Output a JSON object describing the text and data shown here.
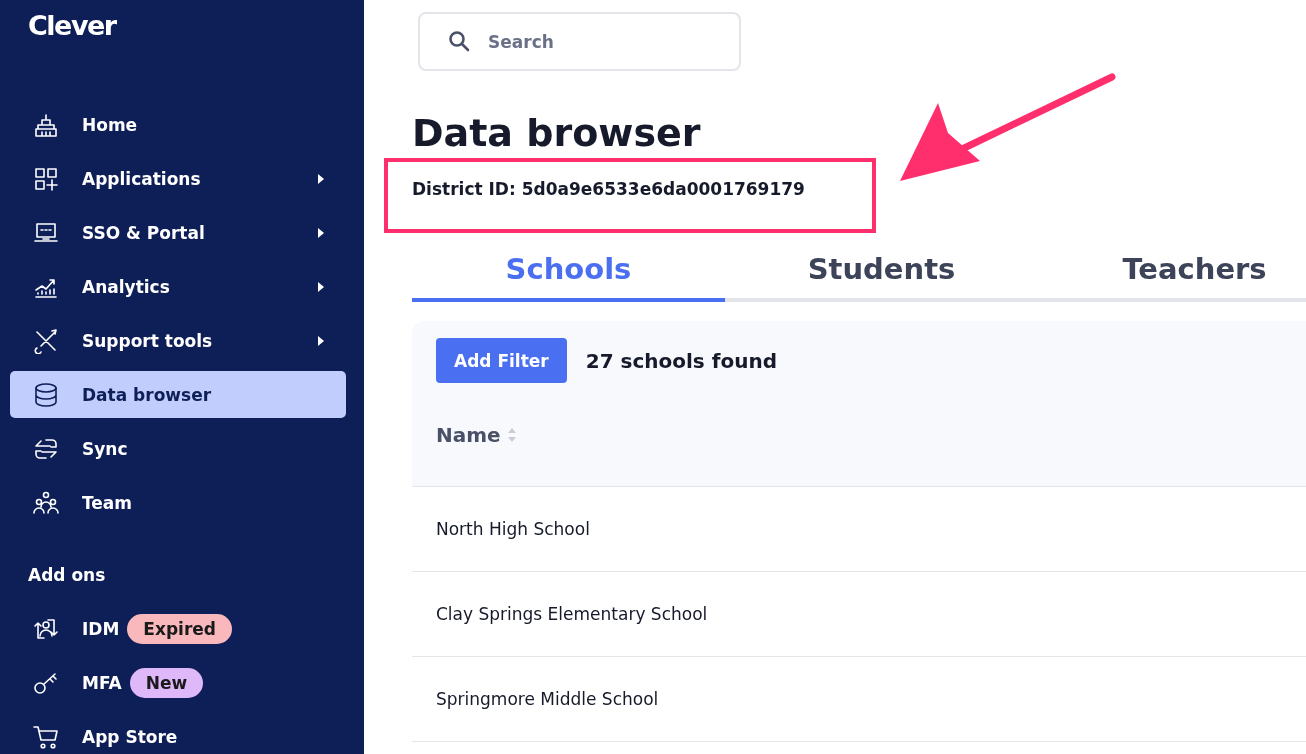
{
  "sidebar": {
    "logo": "Clever",
    "items": [
      {
        "label": "Home",
        "submenu": false,
        "selected": false
      },
      {
        "label": "Applications",
        "submenu": true,
        "selected": false
      },
      {
        "label": "SSO & Portal",
        "submenu": true,
        "selected": false
      },
      {
        "label": "Analytics",
        "submenu": true,
        "selected": false
      },
      {
        "label": "Support tools",
        "submenu": true,
        "selected": false
      },
      {
        "label": "Data browser",
        "submenu": false,
        "selected": true
      },
      {
        "label": "Sync",
        "submenu": false,
        "selected": false
      },
      {
        "label": "Team",
        "submenu": false,
        "selected": false
      }
    ],
    "section": "Add ons",
    "addons": [
      {
        "label": "IDM",
        "badge": "Expired",
        "color": "#f9b8bb"
      },
      {
        "label": "MFA",
        "badge": "New",
        "color": "#deb8f9"
      },
      {
        "label": "App Store"
      }
    ]
  },
  "search": {
    "placeholder": "Search"
  },
  "title": "Data browser",
  "district_id": "District ID: 5d0a9e6533e6da0001769179",
  "tabs": [
    {
      "label": "Schools",
      "selected": true
    },
    {
      "label": "Students",
      "selected": false
    },
    {
      "label": "Teachers",
      "selected": false
    }
  ],
  "toolbar": {
    "button": "Add Filter",
    "count": "27 schools found"
  },
  "table": {
    "columns": [
      "Name"
    ],
    "rows": [
      "North High School",
      "Clay Springs Elementary School",
      "Springmore Middle School"
    ]
  }
}
